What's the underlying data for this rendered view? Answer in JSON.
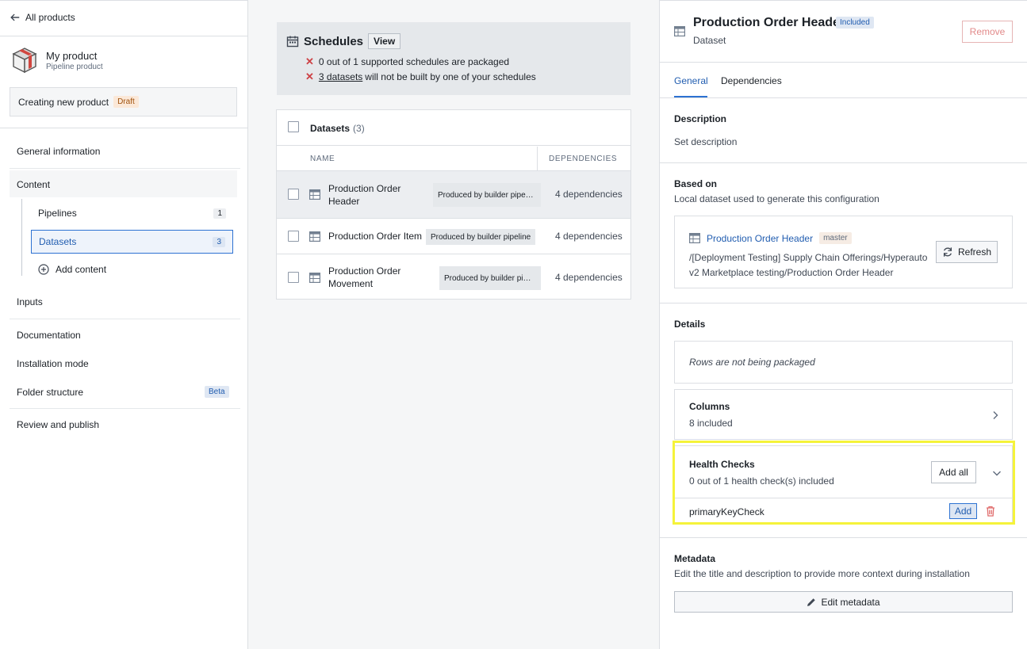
{
  "sidebar": {
    "back_label": "All products",
    "product_name": "My product",
    "product_type": "Pipeline product",
    "creating_label": "Creating new product",
    "draft_tag": "Draft",
    "nav": {
      "general": "General information",
      "content": "Content",
      "pipelines": "Pipelines",
      "pipelines_count": "1",
      "datasets": "Datasets",
      "datasets_count": "3",
      "add_content": "Add content",
      "inputs": "Inputs",
      "documentation": "Documentation",
      "installation": "Installation mode",
      "folder": "Folder structure",
      "beta_tag": "Beta",
      "review": "Review and publish"
    }
  },
  "schedules": {
    "title": "Schedules",
    "view_label": "View",
    "line1": "0 out of 1 supported schedules are packaged",
    "line2_link": "3 datasets",
    "line2_rest": "will not be built by one of your schedules"
  },
  "datasets": {
    "title": "Datasets",
    "count": "(3)",
    "col_name": "NAME",
    "col_deps": "DEPENDENCIES",
    "rows": [
      {
        "name_l1": "Production Order",
        "name_l2": "Header",
        "chip": "Produced by builder pipe…",
        "deps": "4 dependencies"
      },
      {
        "name_l1": "Production Order Item",
        "name_l2": "",
        "chip": "Produced by builder pipeline",
        "deps": "4 dependencies"
      },
      {
        "name_l1": "Production Order",
        "name_l2": "Movement",
        "chip": "Produced by builder pi…",
        "deps": "4 dependencies"
      }
    ]
  },
  "detail": {
    "title": "Production Order Header",
    "included_tag": "Included",
    "subtitle": "Dataset",
    "remove_label": "Remove",
    "tabs": [
      "General",
      "Dependencies"
    ],
    "description_title": "Description",
    "description_text": "Set description",
    "based_on_title": "Based on",
    "based_on_text": "Local dataset used to generate this configuration",
    "source_name": "Production Order Header",
    "branch_tag": "master",
    "path_l1": "/[Deployment Testing] Supply Chain Offerings/Hyperauto",
    "path_l2": "v2 Marketplace testing/Production Order Header",
    "refresh_label": "Refresh",
    "details_title": "Details",
    "rows_text": "Rows are not being packaged",
    "columns_title": "Columns",
    "columns_text": "8 included",
    "health_title": "Health Checks",
    "health_text": "0 out of 1 health check(s) included",
    "add_all_label": "Add all",
    "check_name": "primaryKeyCheck",
    "add_label": "Add",
    "metadata_title": "Metadata",
    "metadata_text": "Edit the title and description to provide more context during installation",
    "edit_metadata_label": "Edit metadata"
  },
  "colors": {
    "accent": "#2d72d2",
    "danger": "#cd4246",
    "highlight": "#f5f33a"
  }
}
